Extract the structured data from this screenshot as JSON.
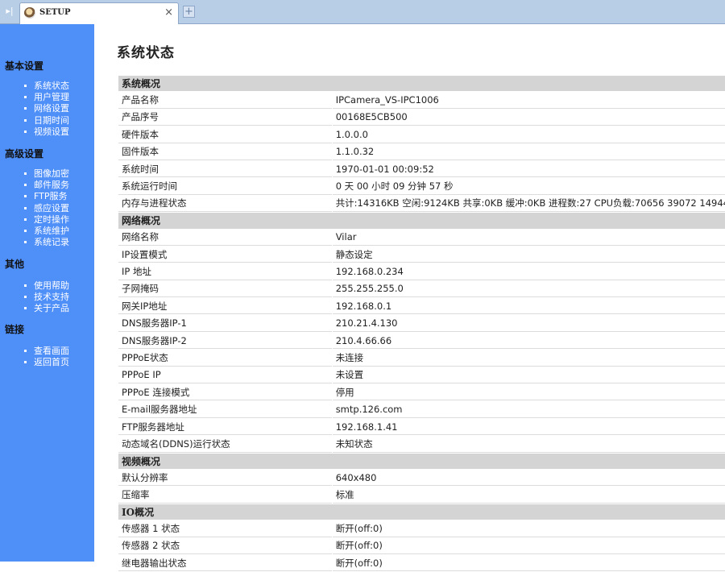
{
  "browser": {
    "nav_icon": "arrow-right-icon",
    "tab_title": "SETUP",
    "tab_close": "×",
    "new_tab": "+"
  },
  "sidebar": {
    "sections": [
      {
        "heading": "基本设置",
        "items": [
          "系统状态",
          "用户管理",
          "网络设置",
          "日期时间",
          "视频设置"
        ]
      },
      {
        "heading": "高级设置",
        "items": [
          "图像加密",
          "邮件服务",
          "FTP服务",
          "感应设置",
          "定时操作",
          "系统维护",
          "系统记录"
        ]
      },
      {
        "heading": "其他",
        "items": [
          "使用帮助",
          "技术支持",
          "关于产品"
        ]
      },
      {
        "heading": "链接",
        "items": [
          "查看画面",
          "返回首页"
        ]
      }
    ]
  },
  "main": {
    "title": "系统状态",
    "groups": [
      {
        "title": "系统概况",
        "rows": [
          [
            "产品名称",
            "IPCamera_VS-IPC1006"
          ],
          [
            "产品序号",
            "00168E5CB500"
          ],
          [
            "硬件版本",
            "1.0.0.0"
          ],
          [
            "固件版本",
            "1.1.0.32"
          ],
          [
            "系统时间",
            "1970-01-01 00:09:52"
          ],
          [
            "系统运行时间",
            "0 天  00 小时  09 分钟  57 秒"
          ],
          [
            "内存与进程状态",
            "共计:14316KB 空闲:9124KB 共享:0KB 缓冲:0KB 进程数:27 CPU负载:70656 39072 14944"
          ]
        ]
      },
      {
        "title": "网络概况",
        "rows": [
          [
            "网络名称",
            "Vilar"
          ],
          [
            "IP设置模式",
            "静态设定"
          ],
          [
            "IP 地址",
            "192.168.0.234"
          ],
          [
            "子网掩码",
            "255.255.255.0"
          ],
          [
            "网关IP地址",
            "192.168.0.1"
          ],
          [
            "DNS服务器IP-1",
            "210.21.4.130"
          ],
          [
            "DNS服务器IP-2",
            "210.4.66.66"
          ],
          [
            "PPPoE状态",
            "未连接"
          ],
          [
            "PPPoE IP",
            "未设置"
          ],
          [
            "PPPoE 连接模式",
            "停用"
          ],
          [
            "E-mail服务器地址",
            "smtp.126.com"
          ],
          [
            "FTP服务器地址",
            "192.168.1.41"
          ],
          [
            "动态域名(DDNS)运行状态",
            "未知状态"
          ]
        ]
      },
      {
        "title": "视频概况",
        "rows": [
          [
            "默认分辨率",
            "640x480"
          ],
          [
            "压缩率",
            "标准"
          ]
        ]
      },
      {
        "title": "IO概况",
        "rows": [
          [
            "传感器  1 状态",
            "断开(off:0)"
          ],
          [
            "传感器  2 状态",
            "断开(off:0)"
          ],
          [
            "继电器输出状态",
            "断开(off:0)"
          ]
        ]
      }
    ]
  }
}
